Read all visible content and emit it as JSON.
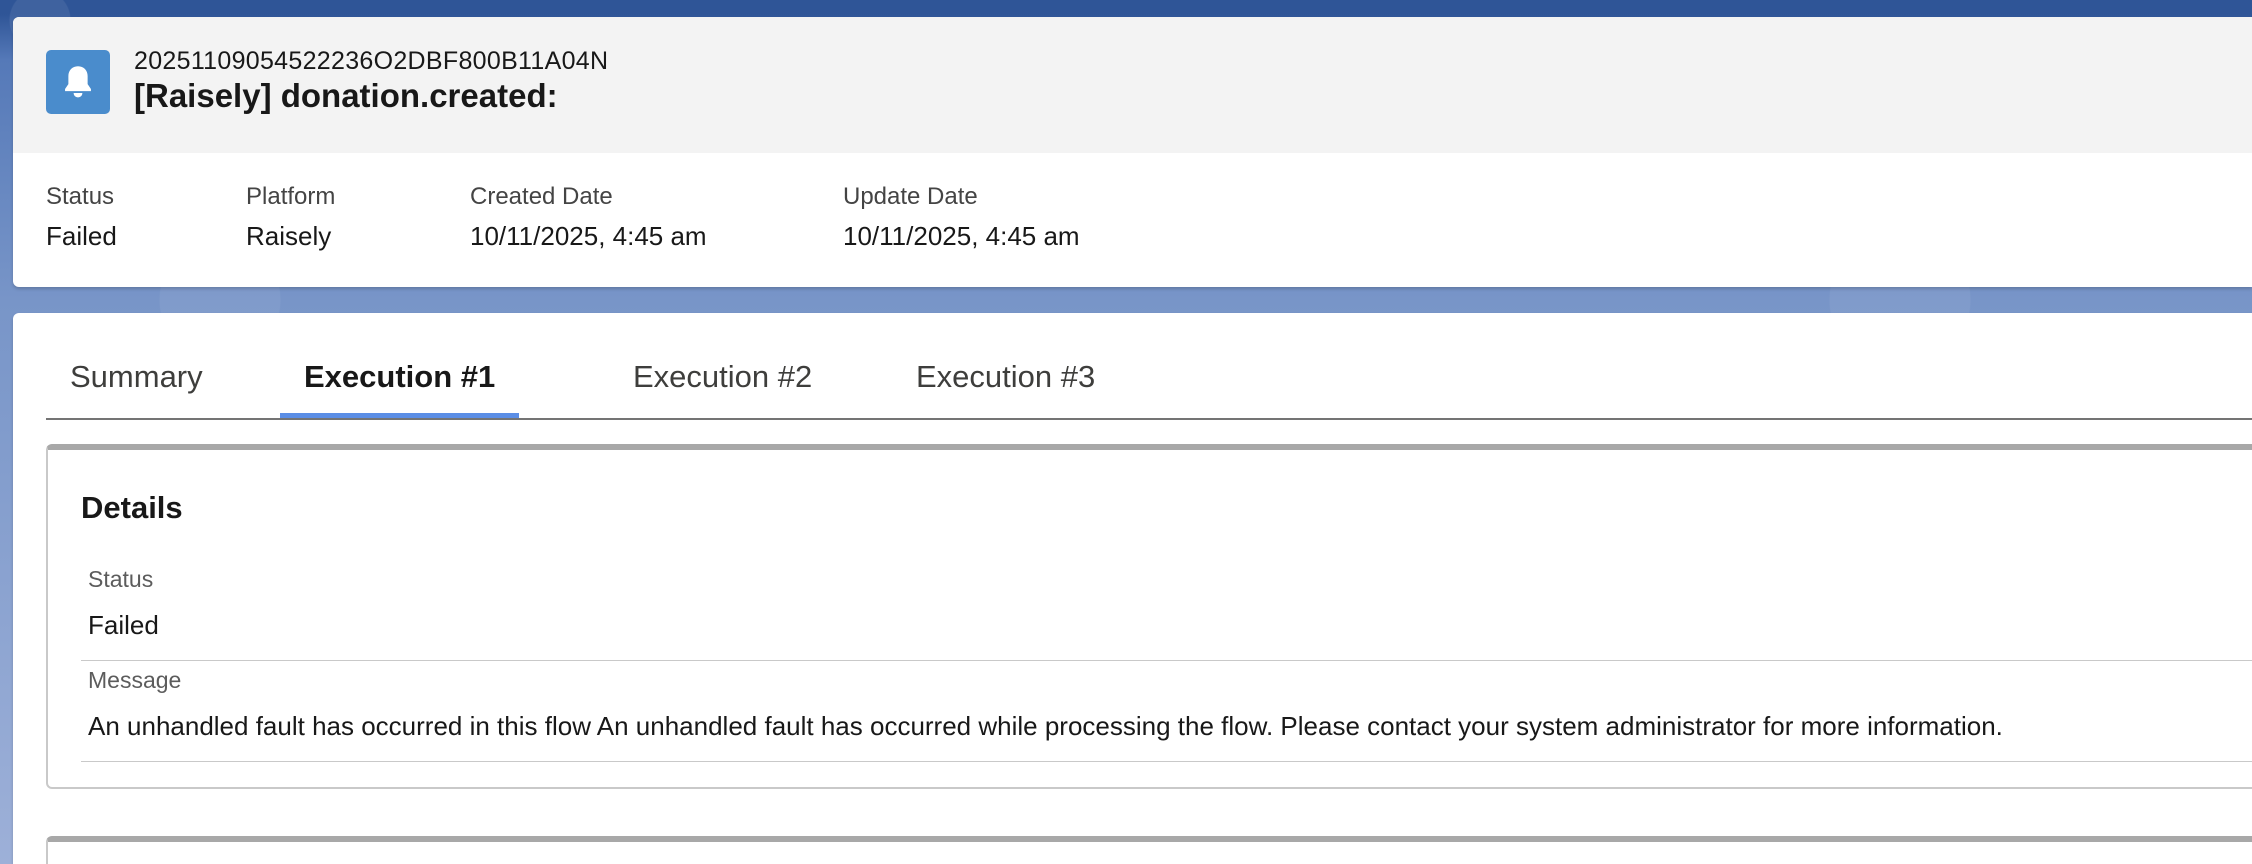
{
  "record": {
    "icon": "bell-icon",
    "id": "20251109054522236O2DBF800B11A04N",
    "title": "[Raisely] donation.created:"
  },
  "highlights": [
    {
      "label": "Status",
      "value": "Failed"
    },
    {
      "label": "Platform",
      "value": "Raisely"
    },
    {
      "label": "Created Date",
      "value": "10/11/2025, 4:45 am"
    },
    {
      "label": "Update Date",
      "value": "10/11/2025, 4:45 am"
    }
  ],
  "tabs": [
    {
      "label": "Summary",
      "active": false
    },
    {
      "label": "Execution #1",
      "active": true
    },
    {
      "label": "Execution #2",
      "active": false
    },
    {
      "label": "Execution #3",
      "active": false
    }
  ],
  "details": {
    "title": "Details",
    "fields": [
      {
        "label": "Status",
        "value": "Failed"
      },
      {
        "label": "Message",
        "value": "An unhandled fault has occurred in this flow An unhandled fault has occurred while processing the flow. Please contact your system administrator for more information."
      }
    ]
  },
  "colors": {
    "icon_bg": "#4a8ccc",
    "active_tab_underline": "#5b8ee6",
    "header_bg": "#f3f3f3"
  }
}
